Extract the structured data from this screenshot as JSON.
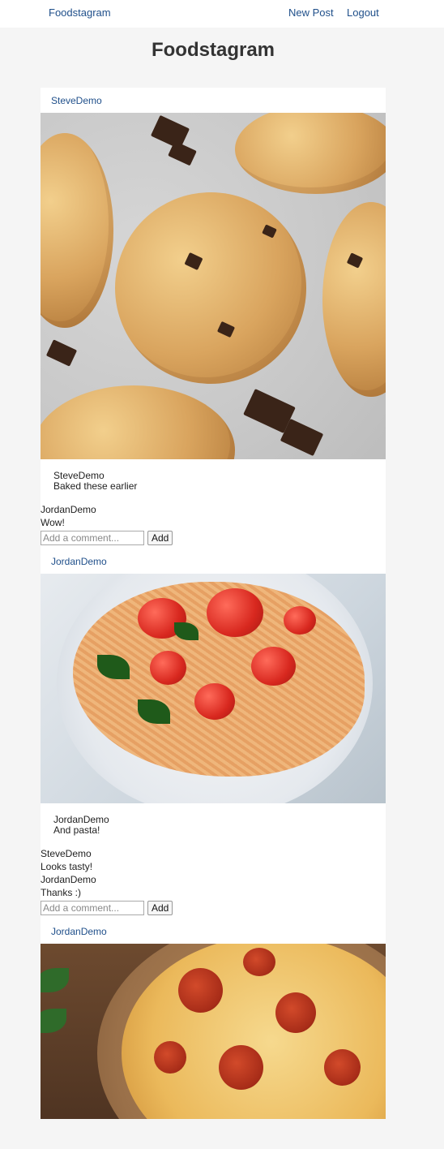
{
  "nav": {
    "brand": "Foodstagram",
    "new_post": "New Post",
    "logout": "Logout"
  },
  "page": {
    "title": "Foodstagram"
  },
  "posts": [
    {
      "author": "SteveDemo",
      "image_description": "cookies",
      "caption_author": "SteveDemo",
      "caption_text": "Baked these earlier",
      "comments": [
        {
          "author": "JordanDemo",
          "text": "Wow!"
        }
      ],
      "comment_placeholder": "Add a comment...",
      "add_label": "Add"
    },
    {
      "author": "JordanDemo",
      "image_description": "pasta",
      "caption_author": "JordanDemo",
      "caption_text": "And pasta!",
      "comments": [
        {
          "author": "SteveDemo",
          "text": "Looks tasty!"
        },
        {
          "author": "JordanDemo",
          "text": "Thanks :)"
        }
      ],
      "comment_placeholder": "Add a comment...",
      "add_label": "Add"
    },
    {
      "author": "JordanDemo",
      "image_description": "pizza"
    }
  ]
}
